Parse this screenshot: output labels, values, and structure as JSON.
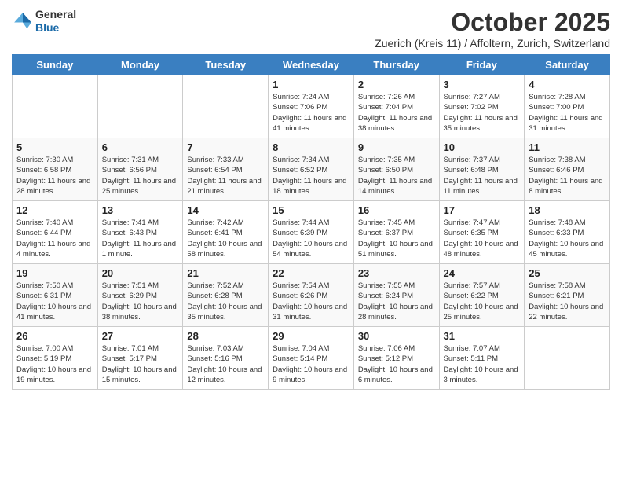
{
  "header": {
    "logo_general": "General",
    "logo_blue": "Blue",
    "month_title": "October 2025",
    "subtitle": "Zuerich (Kreis 11) / Affoltern, Zurich, Switzerland"
  },
  "days_of_week": [
    "Sunday",
    "Monday",
    "Tuesday",
    "Wednesday",
    "Thursday",
    "Friday",
    "Saturday"
  ],
  "weeks": [
    [
      {
        "day": "",
        "info": ""
      },
      {
        "day": "",
        "info": ""
      },
      {
        "day": "",
        "info": ""
      },
      {
        "day": "1",
        "info": "Sunrise: 7:24 AM\nSunset: 7:06 PM\nDaylight: 11 hours and 41 minutes."
      },
      {
        "day": "2",
        "info": "Sunrise: 7:26 AM\nSunset: 7:04 PM\nDaylight: 11 hours and 38 minutes."
      },
      {
        "day": "3",
        "info": "Sunrise: 7:27 AM\nSunset: 7:02 PM\nDaylight: 11 hours and 35 minutes."
      },
      {
        "day": "4",
        "info": "Sunrise: 7:28 AM\nSunset: 7:00 PM\nDaylight: 11 hours and 31 minutes."
      }
    ],
    [
      {
        "day": "5",
        "info": "Sunrise: 7:30 AM\nSunset: 6:58 PM\nDaylight: 11 hours and 28 minutes."
      },
      {
        "day": "6",
        "info": "Sunrise: 7:31 AM\nSunset: 6:56 PM\nDaylight: 11 hours and 25 minutes."
      },
      {
        "day": "7",
        "info": "Sunrise: 7:33 AM\nSunset: 6:54 PM\nDaylight: 11 hours and 21 minutes."
      },
      {
        "day": "8",
        "info": "Sunrise: 7:34 AM\nSunset: 6:52 PM\nDaylight: 11 hours and 18 minutes."
      },
      {
        "day": "9",
        "info": "Sunrise: 7:35 AM\nSunset: 6:50 PM\nDaylight: 11 hours and 14 minutes."
      },
      {
        "day": "10",
        "info": "Sunrise: 7:37 AM\nSunset: 6:48 PM\nDaylight: 11 hours and 11 minutes."
      },
      {
        "day": "11",
        "info": "Sunrise: 7:38 AM\nSunset: 6:46 PM\nDaylight: 11 hours and 8 minutes."
      }
    ],
    [
      {
        "day": "12",
        "info": "Sunrise: 7:40 AM\nSunset: 6:44 PM\nDaylight: 11 hours and 4 minutes."
      },
      {
        "day": "13",
        "info": "Sunrise: 7:41 AM\nSunset: 6:43 PM\nDaylight: 11 hours and 1 minute."
      },
      {
        "day": "14",
        "info": "Sunrise: 7:42 AM\nSunset: 6:41 PM\nDaylight: 10 hours and 58 minutes."
      },
      {
        "day": "15",
        "info": "Sunrise: 7:44 AM\nSunset: 6:39 PM\nDaylight: 10 hours and 54 minutes."
      },
      {
        "day": "16",
        "info": "Sunrise: 7:45 AM\nSunset: 6:37 PM\nDaylight: 10 hours and 51 minutes."
      },
      {
        "day": "17",
        "info": "Sunrise: 7:47 AM\nSunset: 6:35 PM\nDaylight: 10 hours and 48 minutes."
      },
      {
        "day": "18",
        "info": "Sunrise: 7:48 AM\nSunset: 6:33 PM\nDaylight: 10 hours and 45 minutes."
      }
    ],
    [
      {
        "day": "19",
        "info": "Sunrise: 7:50 AM\nSunset: 6:31 PM\nDaylight: 10 hours and 41 minutes."
      },
      {
        "day": "20",
        "info": "Sunrise: 7:51 AM\nSunset: 6:29 PM\nDaylight: 10 hours and 38 minutes."
      },
      {
        "day": "21",
        "info": "Sunrise: 7:52 AM\nSunset: 6:28 PM\nDaylight: 10 hours and 35 minutes."
      },
      {
        "day": "22",
        "info": "Sunrise: 7:54 AM\nSunset: 6:26 PM\nDaylight: 10 hours and 31 minutes."
      },
      {
        "day": "23",
        "info": "Sunrise: 7:55 AM\nSunset: 6:24 PM\nDaylight: 10 hours and 28 minutes."
      },
      {
        "day": "24",
        "info": "Sunrise: 7:57 AM\nSunset: 6:22 PM\nDaylight: 10 hours and 25 minutes."
      },
      {
        "day": "25",
        "info": "Sunrise: 7:58 AM\nSunset: 6:21 PM\nDaylight: 10 hours and 22 minutes."
      }
    ],
    [
      {
        "day": "26",
        "info": "Sunrise: 7:00 AM\nSunset: 5:19 PM\nDaylight: 10 hours and 19 minutes."
      },
      {
        "day": "27",
        "info": "Sunrise: 7:01 AM\nSunset: 5:17 PM\nDaylight: 10 hours and 15 minutes."
      },
      {
        "day": "28",
        "info": "Sunrise: 7:03 AM\nSunset: 5:16 PM\nDaylight: 10 hours and 12 minutes."
      },
      {
        "day": "29",
        "info": "Sunrise: 7:04 AM\nSunset: 5:14 PM\nDaylight: 10 hours and 9 minutes."
      },
      {
        "day": "30",
        "info": "Sunrise: 7:06 AM\nSunset: 5:12 PM\nDaylight: 10 hours and 6 minutes."
      },
      {
        "day": "31",
        "info": "Sunrise: 7:07 AM\nSunset: 5:11 PM\nDaylight: 10 hours and 3 minutes."
      },
      {
        "day": "",
        "info": ""
      }
    ]
  ]
}
